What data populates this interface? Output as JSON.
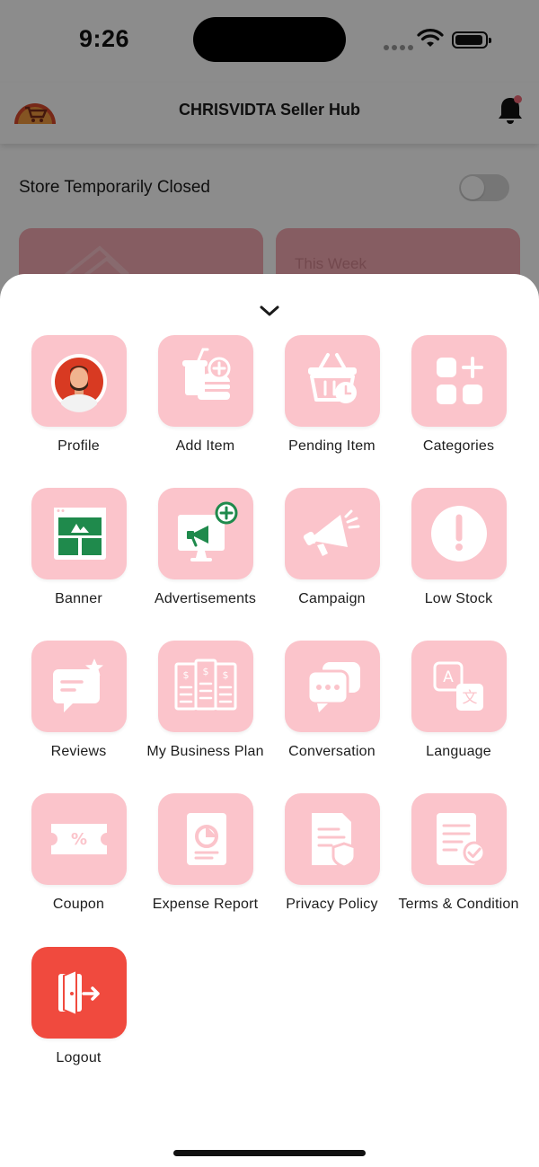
{
  "status_bar": {
    "time": "9:26"
  },
  "header": {
    "title": "CHRISVIDTA Seller Hub"
  },
  "store": {
    "label": "Store Temporarily Closed",
    "closed": false
  },
  "cards": {
    "right_text": "This Week"
  },
  "colors": {
    "tile": "#fbc4cb",
    "logout": "#f04a3e",
    "icon": "#ffffff"
  },
  "menu": {
    "items": [
      {
        "label": "Profile",
        "icon": "avatar-icon"
      },
      {
        "label": "Add Item",
        "icon": "add-food-icon"
      },
      {
        "label": "Pending Item",
        "icon": "basket-clock-icon"
      },
      {
        "label": "Categories",
        "icon": "grid-plus-icon"
      },
      {
        "label": "Banner",
        "icon": "banner-icon"
      },
      {
        "label": "Advertisements",
        "icon": "monitor-megaphone-icon"
      },
      {
        "label": "Campaign",
        "icon": "megaphone-icon"
      },
      {
        "label": "Low Stock",
        "icon": "alert-circle-icon"
      },
      {
        "label": "Reviews",
        "icon": "chat-star-icon"
      },
      {
        "label": "My Business Plan",
        "icon": "plan-icon"
      },
      {
        "label": "Conversation",
        "icon": "chat-bubbles-icon"
      },
      {
        "label": "Language",
        "icon": "translate-icon"
      },
      {
        "label": "Coupon",
        "icon": "coupon-icon"
      },
      {
        "label": "Expense Report",
        "icon": "report-icon"
      },
      {
        "label": "Privacy Policy",
        "icon": "document-shield-icon"
      },
      {
        "label": "Terms & Condition",
        "icon": "document-check-icon"
      },
      {
        "label": "Logout",
        "icon": "logout-icon"
      }
    ]
  }
}
